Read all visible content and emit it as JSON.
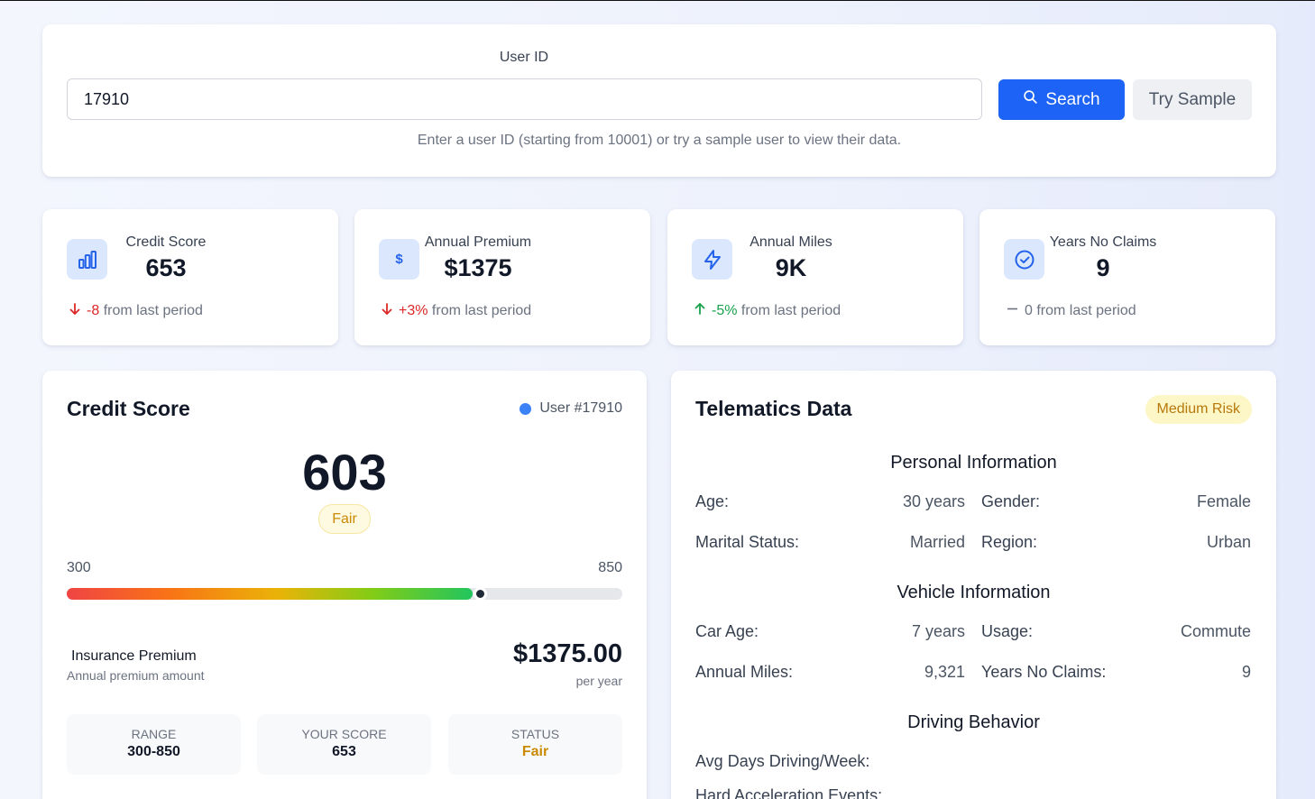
{
  "search": {
    "label": "User ID",
    "value": "17910",
    "search_button": "Search",
    "sample_button": "Try Sample",
    "help": "Enter a user ID (starting from 10001) or try a sample user to view their data."
  },
  "stats": [
    {
      "label": "Credit Score",
      "value": "653",
      "icon": "bar-chart-icon",
      "change": "-8",
      "change_suffix": "from last period",
      "direction": "down"
    },
    {
      "label": "Annual Premium",
      "value": "$1375",
      "icon": "dollar-icon",
      "change": "+3%",
      "change_suffix": "from last period",
      "direction": "down"
    },
    {
      "label": "Annual Miles",
      "value": "9K",
      "icon": "lightning-icon",
      "change": "-5%",
      "change_suffix": "from last period",
      "direction": "up"
    },
    {
      "label": "Years No Claims",
      "value": "9",
      "icon": "check-circle-icon",
      "change": "0",
      "change_suffix": "from last period",
      "direction": "neutral"
    }
  ],
  "credit": {
    "title": "Credit Score",
    "user": "User #17910",
    "score": "603",
    "rating": "Fair",
    "range_min": "300",
    "range_max": "850",
    "bar_fraction": 0.73,
    "premium_label": "Insurance Premium",
    "premium_sub": "Annual premium amount",
    "premium_value": "$1375.00",
    "premium_per": "per year",
    "summary": [
      {
        "label": "RANGE",
        "value": "300-850"
      },
      {
        "label": "YOUR SCORE",
        "value": "653"
      },
      {
        "label": "STATUS",
        "value": "Fair"
      }
    ]
  },
  "telematics": {
    "title": "Telematics Data",
    "risk": "Medium Risk",
    "personal_title": "Personal Information",
    "vehicle_title": "Vehicle Information",
    "driving_title": "Driving Behavior",
    "age_label": "Age:",
    "age_value": "30 years",
    "gender_label": "Gender:",
    "gender_value": "Female",
    "marital_label": "Marital Status:",
    "marital_value": "Married",
    "region_label": "Region:",
    "region_value": "Urban",
    "car_age_label": "Car Age:",
    "car_age_value": "7 years",
    "usage_label": "Usage:",
    "usage_value": "Commute",
    "miles_label": "Annual Miles:",
    "miles_value": "9,321",
    "claims_label": "Years No Claims:",
    "claims_value": "9",
    "days_label": "Avg Days Driving/Week:",
    "hard_accel_label": "Hard Acceleration Events:"
  },
  "colors": {
    "primary": "#1d63f5",
    "negative": "#dc2626",
    "positive": "#16a34a",
    "warning": "#ca8a04"
  }
}
